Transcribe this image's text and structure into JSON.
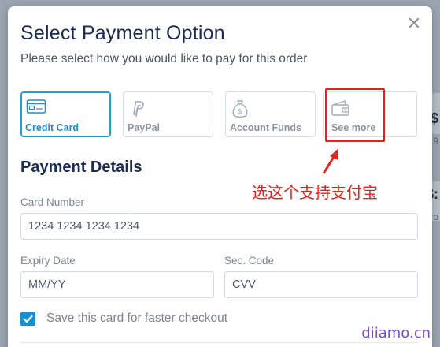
{
  "backdrop": {
    "price_fragment_1": "$",
    "price_fragment_2": "$:",
    "small_1": "9",
    "small_2": "ro"
  },
  "modal": {
    "title": "Select Payment Option",
    "subtitle": "Please select how you would like to pay for this order",
    "close_label": "×"
  },
  "options": [
    {
      "label": "Credit Card",
      "icon": "credit-card-icon",
      "selected": true
    },
    {
      "label": "PayPal",
      "icon": "paypal-icon",
      "selected": false
    },
    {
      "label": "Account Funds",
      "icon": "money-bag-icon",
      "selected": false
    },
    {
      "label": "See more",
      "icon": "wallet-icon",
      "selected": false
    }
  ],
  "annotation": {
    "text": "选这个支持支付宝"
  },
  "payment_details": {
    "title": "Payment Details",
    "card_number": {
      "label": "Card Number",
      "placeholder": "1234 1234 1234 1234"
    },
    "expiry": {
      "label": "Expiry Date",
      "placeholder": "MM/YY"
    },
    "sec_code": {
      "label": "Sec. Code",
      "placeholder": "CVV"
    },
    "save_card": {
      "label": "Save this card for faster checkout",
      "checked": true
    }
  },
  "watermark": "diiamo.cn",
  "colors": {
    "accent": "#1a8fd1",
    "annotation_red": "#e8201a",
    "title": "#1c2b52",
    "watermark": "#7b4ec8"
  }
}
